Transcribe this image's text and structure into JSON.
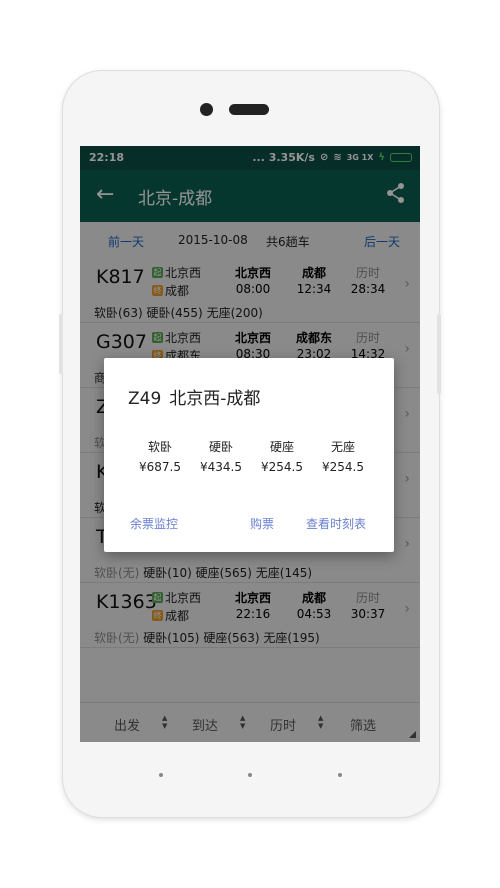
{
  "status": {
    "time": "22:18",
    "network": "... 3.35K/s",
    "signal_text": "3G 1X"
  },
  "appbar": {
    "title": "北京-成都"
  },
  "datebar": {
    "prev_label": "前一天",
    "date": "2015-10-08",
    "total": "共6趟车",
    "next_label": "后一天"
  },
  "trains": [
    {
      "no": "K817",
      "from": "北京西",
      "to": "成都",
      "from_tag": "起",
      "to_tag": "终",
      "dep_station": "北京西",
      "arr_station": "成都",
      "dep": "08:00",
      "arr": "12:34",
      "dur_label": "历时",
      "dur": "28:34",
      "seats": [
        {
          "text": "软卧(63)",
          "na": false
        },
        {
          "text": "硬卧(455)",
          "na": false
        },
        {
          "text": "无座(200)",
          "na": false
        }
      ]
    },
    {
      "no": "G307",
      "from": "北京西",
      "to": "成都东",
      "from_tag": "起",
      "to_tag": "终",
      "dep_station": "北京西",
      "arr_station": "成都东",
      "dep": "08:30",
      "arr": "23:02",
      "dur_label": "历时",
      "dur": "14:32",
      "seats": [
        {
          "text": "商",
          "na": false
        }
      ]
    },
    {
      "no": "Z",
      "from": "",
      "to": "",
      "from_tag": "",
      "to_tag": "",
      "dep_station": "",
      "arr_station": "",
      "dep": "",
      "arr": "",
      "dur_label": "",
      "dur": "",
      "seats": [
        {
          "text": "软",
          "na": true
        }
      ]
    },
    {
      "no": "K",
      "from": "",
      "to": "",
      "from_tag": "",
      "to_tag": "",
      "dep_station": "",
      "arr_station": "",
      "dep": "",
      "arr": "",
      "dur_label": "",
      "dur": "",
      "seats": [
        {
          "text": "软",
          "na": false
        }
      ]
    },
    {
      "no": "T",
      "from": "",
      "to": "",
      "from_tag": "",
      "to_tag": "",
      "dep_station": "",
      "arr_station": "",
      "dep": "",
      "arr": "",
      "dur_label": "",
      "dur": "",
      "seats": [
        {
          "text": "软卧(无)",
          "na": true
        },
        {
          "text": "硬卧(10)",
          "na": false
        },
        {
          "text": "硬座(565)",
          "na": false
        },
        {
          "text": "无座(145)",
          "na": false
        }
      ]
    },
    {
      "no": "K1363",
      "from": "北京西",
      "to": "成都",
      "from_tag": "起",
      "to_tag": "终",
      "dep_station": "北京西",
      "arr_station": "成都",
      "dep": "22:16",
      "arr": "04:53",
      "dur_label": "历时",
      "dur": "30:37",
      "seats": [
        {
          "text": "软卧(无)",
          "na": true
        },
        {
          "text": "硬卧(105)",
          "na": false
        },
        {
          "text": "硬座(563)",
          "na": false
        },
        {
          "text": "无座(195)",
          "na": false
        }
      ]
    }
  ],
  "bottom": {
    "depart": "出发",
    "arrive": "到达",
    "duration": "历时",
    "filter": "筛选"
  },
  "dialog": {
    "train_no": "Z49",
    "route": "北京西-成都",
    "seat_types": [
      "软卧",
      "硬卧",
      "硬座",
      "无座"
    ],
    "prices": [
      "¥687.5",
      "¥434.5",
      "¥254.5",
      "¥254.5"
    ],
    "btn_monitor": "余票监控",
    "btn_buy": "购票",
    "btn_schedule": "查看时刻表"
  },
  "colors": {
    "statusbar": "#0b4f45",
    "appbar": "#0b6050",
    "link": "#1e62c0",
    "dialog_button": "#6a7fd0"
  }
}
